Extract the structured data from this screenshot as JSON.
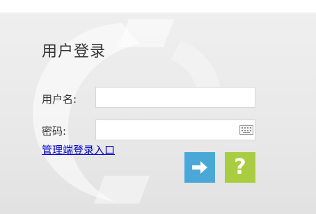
{
  "login": {
    "title": "用户登录",
    "username_label": "用户名:",
    "username_value": "",
    "password_label": "密码:",
    "password_value": "",
    "admin_link": "管理端登录入口",
    "help_glyph": "?"
  },
  "icons": {
    "submit": "arrow-right-icon",
    "help": "question-mark-icon",
    "keyboard": "keyboard-icon"
  },
  "colors": {
    "submit_button": "#4aa8d8",
    "help_button": "#a9cd3e",
    "link": "#0000cc"
  }
}
